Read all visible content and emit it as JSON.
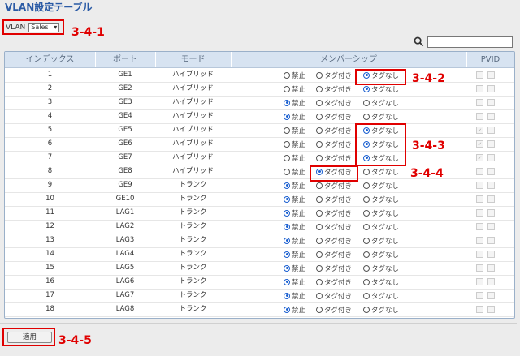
{
  "page": {
    "title": "VLAN設定テーブル"
  },
  "vlan_select": {
    "label": "VLAN",
    "value": "Sales"
  },
  "callouts": {
    "c1": "3-4-1",
    "c2": "3-4-2",
    "c3": "3-4-3",
    "c4": "3-4-4",
    "c5": "3-4-5"
  },
  "search": {
    "value": ""
  },
  "table": {
    "headers": {
      "index": "インデックス",
      "port": "ポート",
      "mode": "モード",
      "membership": "メンバーシップ",
      "pvid": "PVID"
    },
    "option_labels": {
      "forbidden": "禁止",
      "tagged": "タグ付き",
      "untagged": "タグなし"
    },
    "rows": [
      {
        "index": "1",
        "port": "GE1",
        "mode": "ハイブリッド",
        "membership": "untagged",
        "pvid": false
      },
      {
        "index": "2",
        "port": "GE2",
        "mode": "ハイブリッド",
        "membership": "untagged",
        "pvid": false
      },
      {
        "index": "3",
        "port": "GE3",
        "mode": "ハイブリッド",
        "membership": "forbidden",
        "pvid": false
      },
      {
        "index": "4",
        "port": "GE4",
        "mode": "ハイブリッド",
        "membership": "forbidden",
        "pvid": false
      },
      {
        "index": "5",
        "port": "GE5",
        "mode": "ハイブリッド",
        "membership": "untagged",
        "pvid": true
      },
      {
        "index": "6",
        "port": "GE6",
        "mode": "ハイブリッド",
        "membership": "untagged",
        "pvid": true
      },
      {
        "index": "7",
        "port": "GE7",
        "mode": "ハイブリッド",
        "membership": "untagged",
        "pvid": true
      },
      {
        "index": "8",
        "port": "GE8",
        "mode": "ハイブリッド",
        "membership": "tagged",
        "pvid": false
      },
      {
        "index": "9",
        "port": "GE9",
        "mode": "トランク",
        "membership": "forbidden",
        "pvid": false
      },
      {
        "index": "10",
        "port": "GE10",
        "mode": "トランク",
        "membership": "forbidden",
        "pvid": false
      },
      {
        "index": "11",
        "port": "LAG1",
        "mode": "トランク",
        "membership": "forbidden",
        "pvid": false
      },
      {
        "index": "12",
        "port": "LAG2",
        "mode": "トランク",
        "membership": "forbidden",
        "pvid": false
      },
      {
        "index": "13",
        "port": "LAG3",
        "mode": "トランク",
        "membership": "forbidden",
        "pvid": false
      },
      {
        "index": "14",
        "port": "LAG4",
        "mode": "トランク",
        "membership": "forbidden",
        "pvid": false
      },
      {
        "index": "15",
        "port": "LAG5",
        "mode": "トランク",
        "membership": "forbidden",
        "pvid": false
      },
      {
        "index": "16",
        "port": "LAG6",
        "mode": "トランク",
        "membership": "forbidden",
        "pvid": false
      },
      {
        "index": "17",
        "port": "LAG7",
        "mode": "トランク",
        "membership": "forbidden",
        "pvid": false
      },
      {
        "index": "18",
        "port": "LAG8",
        "mode": "トランク",
        "membership": "forbidden",
        "pvid": false
      }
    ]
  },
  "apply_button": {
    "label": "適用"
  },
  "colors": {
    "accent": "#2a5aa5",
    "highlight": "#e00000",
    "header_bg": "#d7e3f1",
    "radio_on": "#1a5fd0"
  }
}
